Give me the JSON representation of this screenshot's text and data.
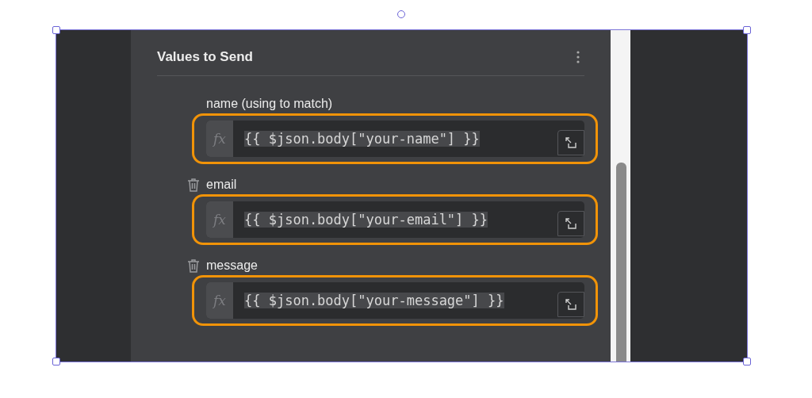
{
  "panel": {
    "title": "Values to Send"
  },
  "fields": [
    {
      "label": "name (using to match)",
      "deletable": false,
      "fx_label": "fx",
      "value": "{{ $json.body[\"your-name\"] }}",
      "highlighted": true
    },
    {
      "label": "email",
      "deletable": true,
      "fx_label": "fx",
      "value": "{{ $json.body[\"your-email\"] }}",
      "highlighted": true
    },
    {
      "label": "message",
      "deletable": true,
      "fx_label": "fx",
      "value": "{{ $json.body[\"your-message\"] }}",
      "highlighted": true
    }
  ]
}
